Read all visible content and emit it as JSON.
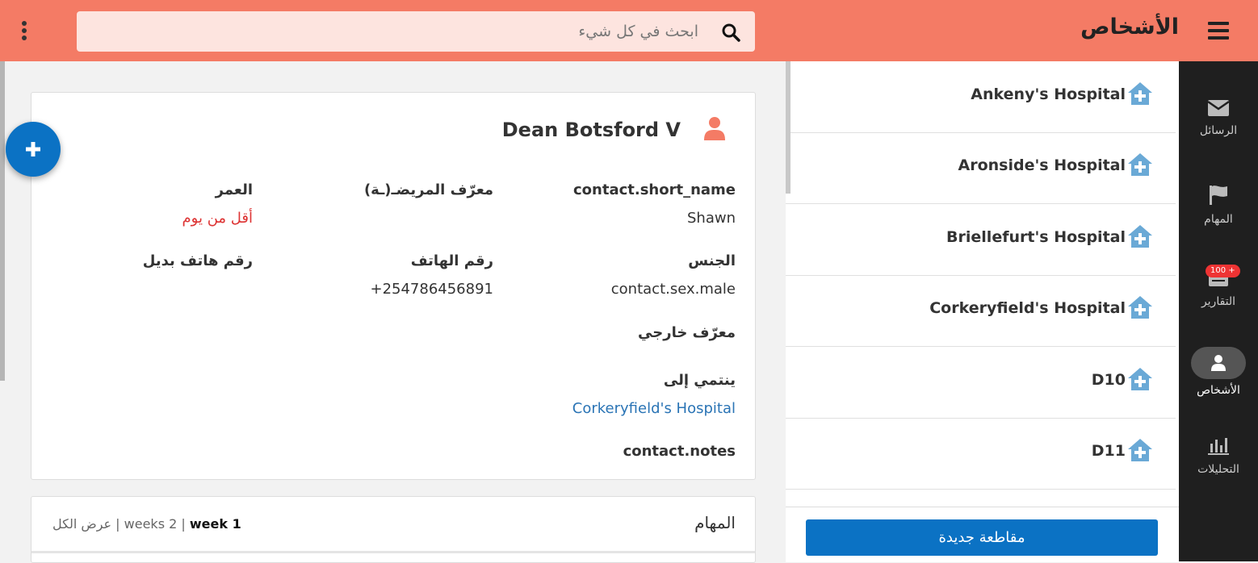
{
  "header": {
    "title": "الأشخاص",
    "search_placeholder": "ابحث في كل شيء",
    "colors": {
      "bar": "#f47b65",
      "search_bg": "#fde4df"
    }
  },
  "nav": {
    "items": [
      {
        "label": "الرسائل",
        "icon": "envelope-icon"
      },
      {
        "label": "المهام",
        "icon": "flag-icon"
      },
      {
        "label": "التقارير",
        "icon": "reports-icon",
        "badge": "100 +"
      },
      {
        "label": "الأشخاص",
        "icon": "person-icon",
        "active": true
      },
      {
        "label": "التحليلات",
        "icon": "bar-chart-icon"
      }
    ]
  },
  "contacts": {
    "items": [
      {
        "name": "Ankeny's Hospital",
        "icon": "hospital-icon"
      },
      {
        "name": "Aronside's Hospital",
        "icon": "hospital-icon"
      },
      {
        "name": "Briellefurt's Hospital",
        "icon": "hospital-icon"
      },
      {
        "name": "Corkeryfield's Hospital",
        "icon": "hospital-icon"
      },
      {
        "name": "D10",
        "icon": "hospital-icon"
      },
      {
        "name": "D11",
        "icon": "hospital-icon"
      }
    ],
    "new_action_label": "مقاطعة جديدة"
  },
  "person": {
    "name": "Dean Botsford V",
    "fields": {
      "short_name": {
        "label": "contact.short_name",
        "value": "Shawn"
      },
      "patient_id": {
        "label": "معرّف المريضـ(ـة)",
        "value": ""
      },
      "age": {
        "label": "العمر",
        "value": "أقل من يوم"
      },
      "sex": {
        "label": "الجنس",
        "value": "contact.sex.male"
      },
      "phone": {
        "label": "رقم الهاتف",
        "value": "+254786456891"
      },
      "alt_phone": {
        "label": "رقم هاتف بديل",
        "value": ""
      },
      "external_id": {
        "label": "معرّف خارجي",
        "value": ""
      },
      "parent": {
        "label": "ينتمي إلى",
        "value": "Corkeryfield's Hospital"
      },
      "notes": {
        "label": "contact.notes",
        "value": ""
      }
    }
  },
  "tasks": {
    "title": "المهام",
    "filters": {
      "week1": "week 1",
      "weeks2": "weeks 2",
      "all": "عرض الكل",
      "sep": "|"
    }
  },
  "colors": {
    "primary": "#0b72c4",
    "accent": "#f47b65",
    "age_value": "#dd3333",
    "link": "#2a74b5"
  }
}
